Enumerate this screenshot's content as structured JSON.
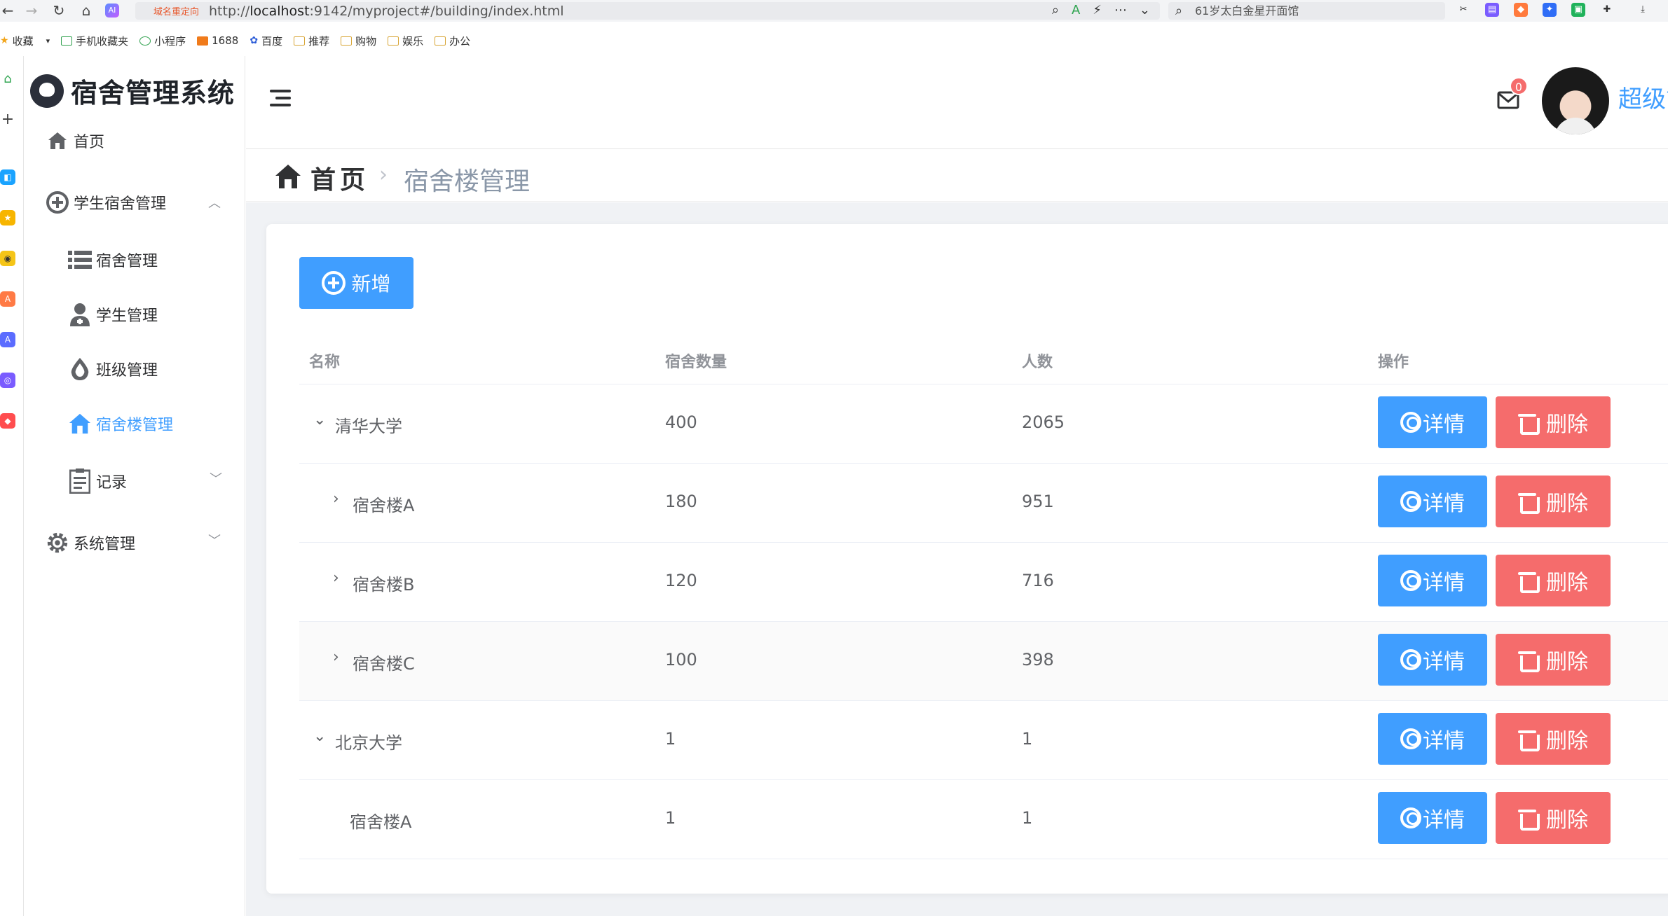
{
  "browser": {
    "redirect_tag": "域名重定向",
    "url_prefix": "http://",
    "url_host": "localhost",
    "url_rest": ":9142/myproject#/building/index.html",
    "search_text": "61岁太白金星开面馆",
    "bookmarks": [
      "收藏",
      "手机收藏夹",
      "小程序",
      "1688",
      "百度",
      "推荐",
      "购物",
      "娱乐",
      "办公"
    ]
  },
  "sidebar": {
    "title": "宿舍管理系统",
    "items": [
      {
        "label": "首页"
      },
      {
        "label": "学生宿舍管理"
      },
      {
        "label": "宿舍管理"
      },
      {
        "label": "学生管理"
      },
      {
        "label": "班级管理"
      },
      {
        "label": "宿舍楼管理"
      },
      {
        "label": "记录"
      },
      {
        "label": "系统管理"
      }
    ]
  },
  "header": {
    "mail_badge": "0",
    "username": "超级管"
  },
  "breadcrumb": {
    "home": "首页",
    "current": "宿舍楼管理"
  },
  "toolbar": {
    "add_label": "新增"
  },
  "table": {
    "columns": [
      "名称",
      "宿舍数量",
      "人数",
      "操作"
    ],
    "detail_label": "详情",
    "delete_label": "删除",
    "rows": [
      {
        "name": "清华大学",
        "rooms": "400",
        "people": "2065"
      },
      {
        "name": "宿舍楼A",
        "rooms": "180",
        "people": "951"
      },
      {
        "name": "宿舍楼B",
        "rooms": "120",
        "people": "716"
      },
      {
        "name": "宿舍楼C",
        "rooms": "100",
        "people": "398"
      },
      {
        "name": "北京大学",
        "rooms": "1",
        "people": "1"
      },
      {
        "name": "宿舍楼A",
        "rooms": "1",
        "people": "1"
      }
    ]
  },
  "colors": {
    "primary": "#409eff",
    "danger": "#f56c6c",
    "content_bg": "#f0f2f5"
  }
}
